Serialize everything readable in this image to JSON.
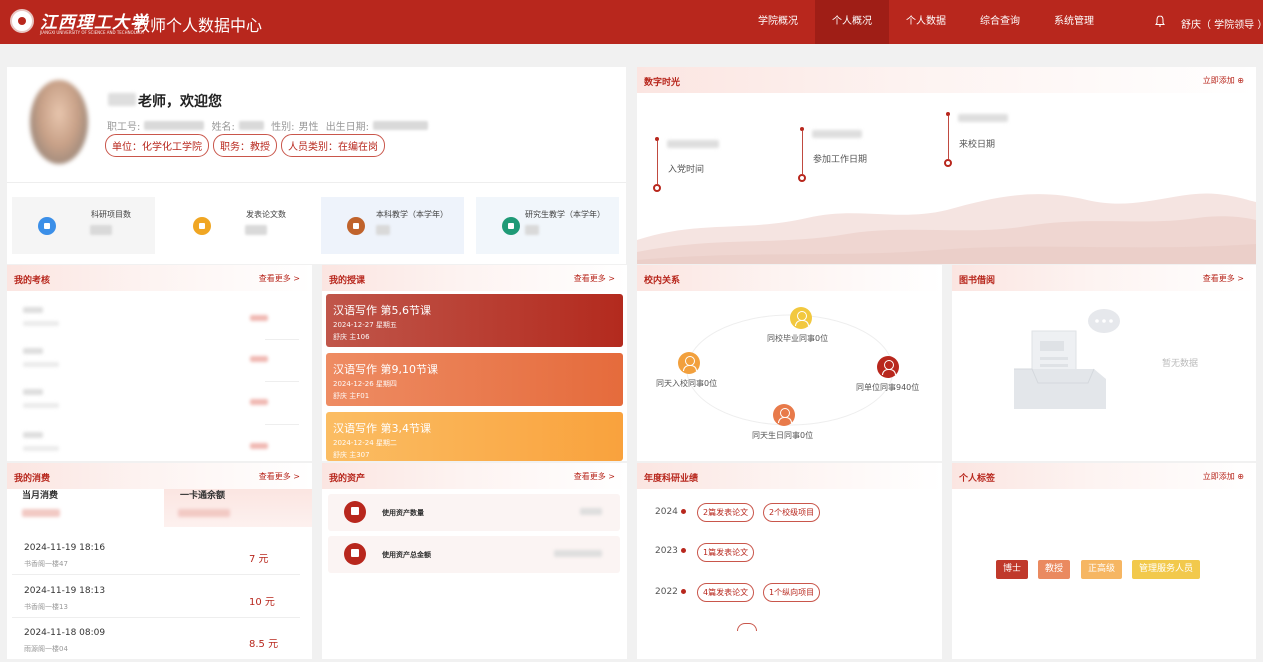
{
  "header": {
    "logo_text": "江西理工大学",
    "logo_en": "JIANGXI UNIVERSITY OF SCIENCE AND TECHNOLOGY",
    "title": "教师个人数据中心",
    "nav": [
      "学院概况",
      "个人概况",
      "个人数据",
      "综合查询",
      "系统管理"
    ],
    "active_nav": "个人概况",
    "user": "舒庆（ 学院领导 ）"
  },
  "profile": {
    "welcome": "老师，欢迎您",
    "staff_id_label": "职工号:",
    "name_label": "姓名:",
    "gender_label": "性别:",
    "gender": "男性",
    "birth_label": "出生日期:",
    "unit": "单位：化学化工学院",
    "position": "职务：教授",
    "staff_type": "人员类别：在编在岗",
    "stats": [
      {
        "label": "科研项目数",
        "color": "#3b8fe8"
      },
      {
        "label": "发表论文数",
        "color": "#f0a623"
      },
      {
        "label": "本科教学（本学年）",
        "color": "#c0632c"
      },
      {
        "label": "研究生教学（本学年）",
        "color": "#1f9a76"
      }
    ]
  },
  "digital_time": {
    "title": "数字时光",
    "add": "立即添加 ⊕",
    "events": [
      "入党时间",
      "参加工作日期",
      "来校日期"
    ]
  },
  "assessment": {
    "title": "我的考核",
    "more": "查看更多 >"
  },
  "teaching": {
    "title": "我的授课",
    "more": "查看更多 >",
    "lessons": [
      {
        "title": "汉语写作 第5,6节课",
        "date": "2024-12-27 星期五",
        "room": "舒庆 主106",
        "color": "#b83424"
      },
      {
        "title": "汉语写作 第9,10节课",
        "date": "2024-12-26 星期四",
        "room": "舒庆 主F01",
        "color": "#e8754a"
      },
      {
        "title": "汉语写作 第3,4节课",
        "date": "2024-12-24 星期二",
        "room": "舒庆 主307",
        "color": "#f8a84a"
      }
    ]
  },
  "relations": {
    "title": "校内关系",
    "nodes": [
      {
        "label": "同校毕业同事0位",
        "color": "#f2c83e"
      },
      {
        "label": "同天入校同事0位",
        "color": "#f2a03d"
      },
      {
        "label": "同单位同事940位",
        "color": "#b8271d"
      },
      {
        "label": "同天生日同事0位",
        "color": "#e87a4a"
      }
    ]
  },
  "library": {
    "title": "图书借阅",
    "more": "查看更多 >",
    "empty": "暂无数据"
  },
  "consumption": {
    "title": "我的消费",
    "more": "查看更多 >",
    "month_label": "当月消费",
    "balance_label": "一卡通余额",
    "records": [
      {
        "time": "2024-11-19 18:16",
        "place": "书香阁一楼47",
        "amount": "7 元"
      },
      {
        "time": "2024-11-19 18:13",
        "place": "书香阁一楼13",
        "amount": "10 元"
      },
      {
        "time": "2024-11-18 08:09",
        "place": "雨源阁一楼04",
        "amount": "8.5 元"
      }
    ]
  },
  "assets": {
    "title": "我的资产",
    "more": "查看更多 >",
    "items": [
      "使用资产数量",
      "使用资产总金额"
    ]
  },
  "research": {
    "title": "年度科研业绩",
    "years": [
      {
        "year": "2024",
        "tags": [
          "2篇发表论文",
          "2个校级项目"
        ]
      },
      {
        "year": "2023",
        "tags": [
          "1篇发表论文"
        ]
      },
      {
        "year": "2022",
        "tags": [
          "4篇发表论文",
          "1个纵向项目"
        ]
      }
    ]
  },
  "personal_tags": {
    "title": "个人标签",
    "add": "立即添加 ⊕",
    "tags": [
      {
        "label": "博士",
        "color": "#c0392b"
      },
      {
        "label": "教授",
        "color": "#ea8a60"
      },
      {
        "label": "正高级",
        "color": "#f6b663"
      },
      {
        "label": "管理服务人员",
        "color": "#f2c94c"
      }
    ]
  }
}
